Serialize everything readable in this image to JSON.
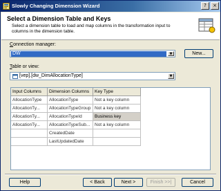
{
  "window": {
    "title": "Slowly Changing Dimension Wizard"
  },
  "titlebar_buttons": {
    "help": "?",
    "close": "×"
  },
  "header": {
    "title": "Select a Dimension Table and Keys",
    "description": "Select a dimension table to load and map columns in the transformation input to columns in the dimension table."
  },
  "connection": {
    "label_prefix": "C",
    "label_rest": "onnection manager:",
    "value": "DW",
    "new_button": "New..."
  },
  "table": {
    "label_prefix": "T",
    "label_rest": "able or view:",
    "value": "[vep].[dw_DimAllocationType]"
  },
  "grid": {
    "headers": [
      "Input Columns",
      "Dimension Columns",
      "Key Type"
    ],
    "rows": [
      [
        "AllocationType",
        "AllocationType",
        "Not a key column"
      ],
      [
        "AllocationTy...",
        "AllocationTypeGroup",
        "Not a key column"
      ],
      [
        "AllocationTy...",
        "AllocationTypeId",
        "Business key"
      ],
      [
        "AllocationTy...",
        "AllocationTypeSub...",
        "Not a key column"
      ],
      [
        "",
        "CreatedDate",
        ""
      ],
      [
        "",
        "LastUpdatedDate",
        ""
      ]
    ],
    "highlighted_row": 2
  },
  "footer": {
    "help": "Help",
    "back": "< Back",
    "next": "Next >",
    "finish": "Finish >>|",
    "cancel": "Cancel"
  },
  "colors": {
    "titlebar": "#0a246a",
    "selection": "#316ac5",
    "face": "#ece9d8"
  }
}
